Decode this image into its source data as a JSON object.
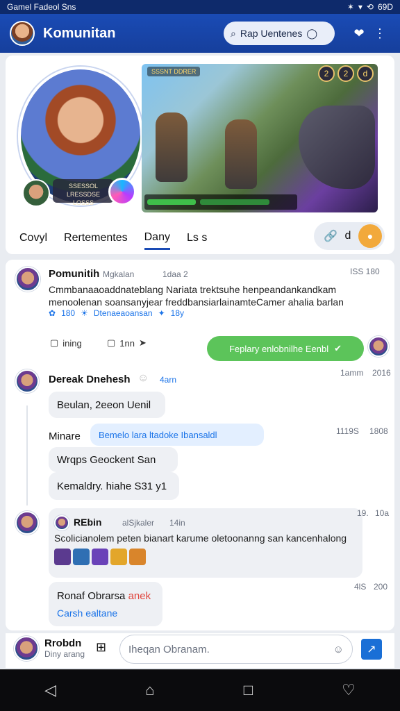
{
  "status_bar": {
    "left": "Gamel Fadeol Sns",
    "right": "69D"
  },
  "app_bar": {
    "title": "Komunitan",
    "search_placeholder": "Rap Uentenes",
    "icons": [
      "hearts-icon",
      "more-vert-icon"
    ]
  },
  "top_card": {
    "profile_caption_line1": "SSESSOL LRESSDSE",
    "profile_caption_line2": "LOSSS",
    "game_hud_top": "SSSNT DDRER",
    "game_hud_icons": [
      "2",
      "2",
      "d"
    ],
    "tabs": [
      "Covyl",
      "Rertementes",
      "Dany",
      "Ls s"
    ],
    "active_tab": 2,
    "tab_action_label": "d"
  },
  "post1": {
    "author": "Pomunitih",
    "badge_handle": "Mgkalan",
    "time_inline": "1daa 2",
    "meta_right": "ISS 180",
    "text_line1": "Cmmbanaaoaddnateblang Nariata trektsuhe henpeandankandkam",
    "text_line2": "menoolenan soansanyjear freddbansiarlainamteCamer ahalia barlan",
    "reaction_count": "180",
    "reaction_label": "Dtenaeaoansan",
    "reaction_tail": "18y",
    "action_like": "ining",
    "action_comment": "1nn",
    "cta_text": "Feplary enlobnilhe Eenbl"
  },
  "comment1": {
    "author": "Dereak Dnehesh",
    "time": "4arn",
    "meta_left": "1amm",
    "meta_right": "2016",
    "bubble": "Beulan, 2eeon Uenil"
  },
  "reply1": {
    "author": "Minare",
    "link": "Bemelo lara ltadoke Ibansaldl",
    "meta_left": "1119S",
    "meta_right": "1808",
    "bubble1": "Wrqps    Geockent San",
    "bubble2": "Kemaldry. hiahe S31 y1"
  },
  "quote": {
    "author": "REbin",
    "handle": "alSjkaler",
    "time": "14in",
    "meta_left": "19.",
    "meta_right": "10a",
    "text": "Scolicianolem peten bianart karume oletoonanng san kancenhalong"
  },
  "reply2": {
    "author": "Ronaf Obrarsa",
    "tag": "anek",
    "link": "Carsh ealtane",
    "meta_left": "4lS",
    "meta_right": "200"
  },
  "composer": {
    "name": "Rrobdn",
    "subtext": "Diny arang",
    "placeholder": "Iheqan Obranam."
  }
}
